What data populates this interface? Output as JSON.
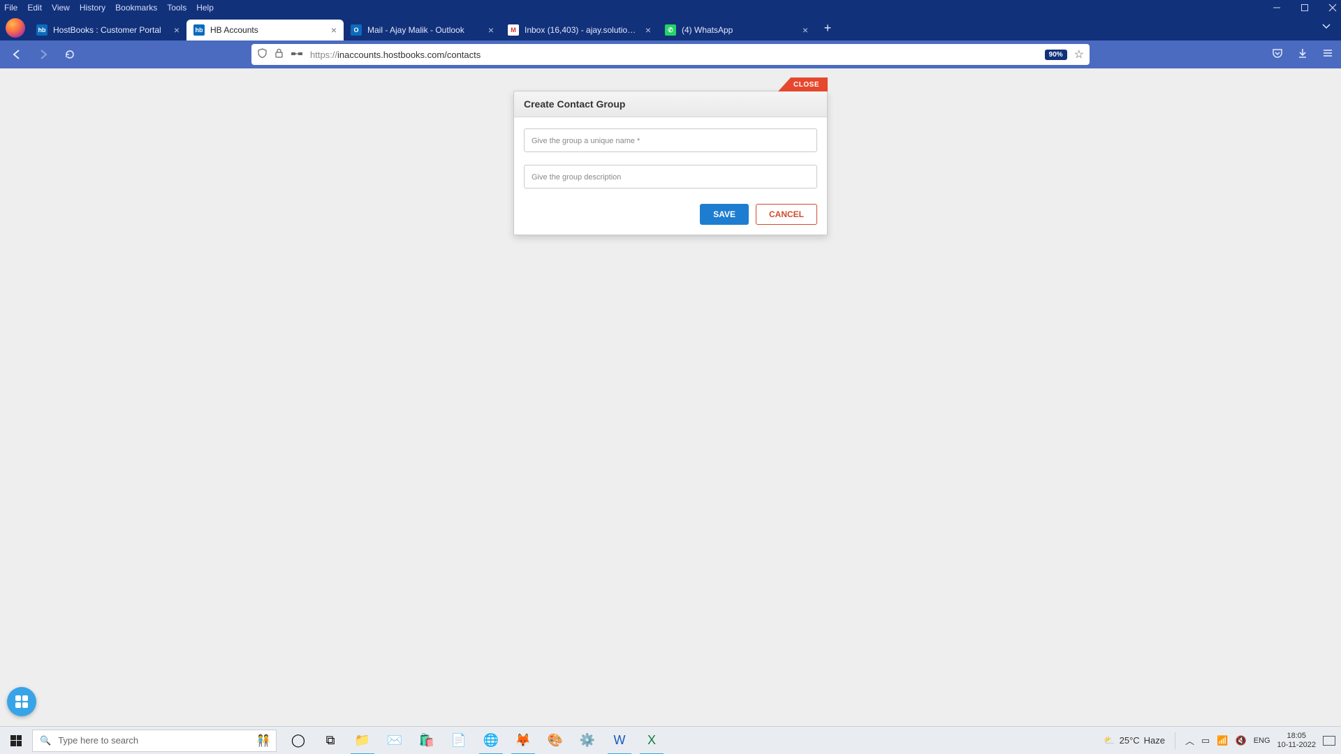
{
  "menubar": {
    "items": [
      "File",
      "Edit",
      "View",
      "History",
      "Bookmarks",
      "Tools",
      "Help"
    ]
  },
  "tabs": [
    {
      "title": "HostBooks : Customer Portal",
      "favicon_bg": "#0b6bbd",
      "favicon_txt": "hb",
      "active": false
    },
    {
      "title": "HB Accounts",
      "favicon_bg": "#0b6bbd",
      "favicon_txt": "hb",
      "active": true
    },
    {
      "title": "Mail - Ajay Malik - Outlook",
      "favicon_bg": "#0b6bbd",
      "favicon_txt": "O",
      "active": false
    },
    {
      "title": "Inbox (16,403) - ajay.solutions@",
      "favicon_bg": "#ffffff",
      "favicon_txt": "M",
      "active": false,
      "favicon_fg": "#d93025"
    },
    {
      "title": "(4) WhatsApp",
      "favicon_bg": "#25d366",
      "favicon_txt": "✆",
      "active": false
    }
  ],
  "url": {
    "proto": "https://",
    "host_path": "inaccounts.hostbooks.com/contacts",
    "zoom": "90%"
  },
  "modal": {
    "close": "CLOSE",
    "title": "Create Contact Group",
    "name_placeholder": "Give the group a unique name *",
    "desc_placeholder": "Give the group description",
    "save": "SAVE",
    "cancel": "CANCEL"
  },
  "taskbar": {
    "search_placeholder": "Type here to search",
    "weather_temp": "25°C",
    "weather_desc": "Haze",
    "lang": "ENG",
    "time": "18:05",
    "date": "10-11-2022"
  }
}
